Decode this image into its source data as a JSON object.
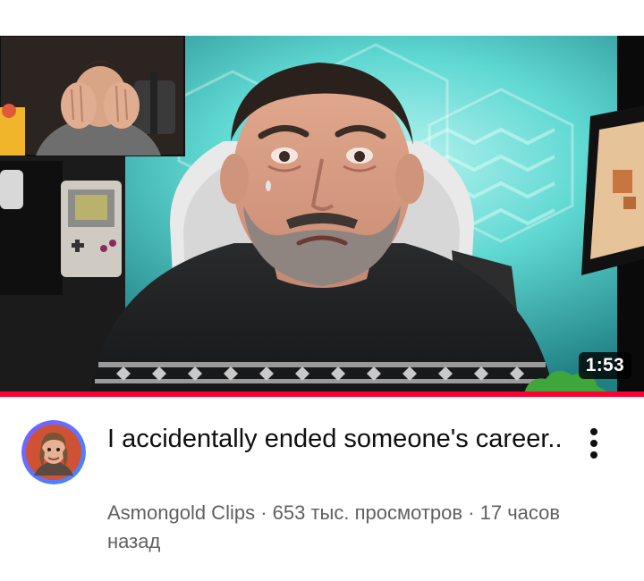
{
  "video": {
    "duration": "1:53",
    "watch_progress": 1.0,
    "title": "I accidentally ended someone's career..",
    "channel": "Asmongold Clips",
    "separator": " · ",
    "views": "653 тыс. просмотров",
    "age": "17 часов назад"
  },
  "icons": {
    "more": "vertical-ellipsis-icon"
  },
  "colors": {
    "progress": "#ff0033",
    "title": "#0f0f0f",
    "subtitle": "#606060",
    "avatar_ring": "#5865f2"
  }
}
